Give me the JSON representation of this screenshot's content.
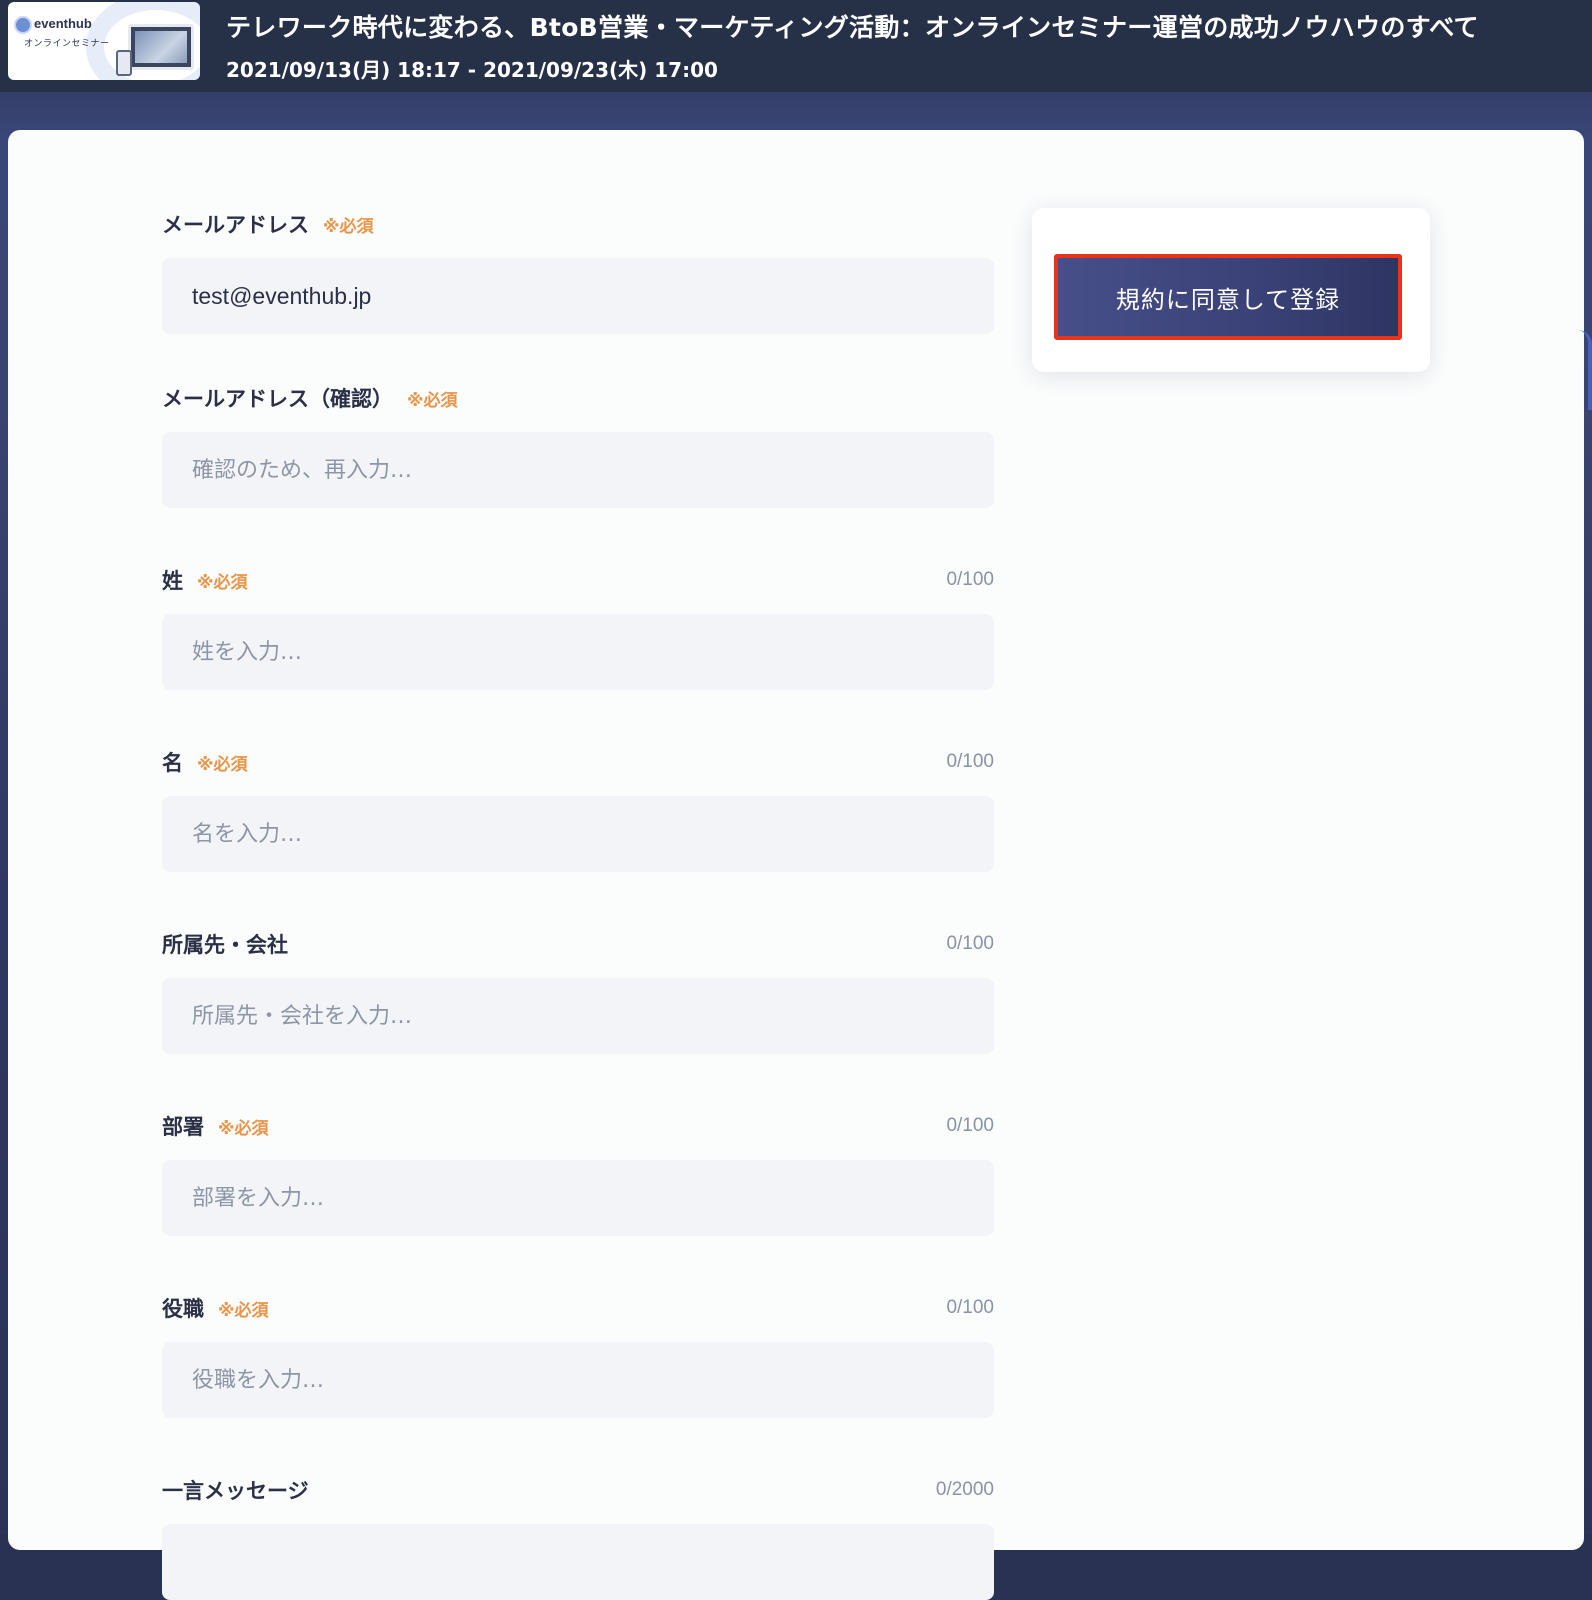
{
  "header": {
    "thumbnail": {
      "logo_text": "eventhub",
      "subtitle": "オンラインセミナー"
    },
    "event_title": "テレワーク時代に変わる、BtoB営業・マーケティング活動：オンラインセミナー運営の成功ノウハウのすべて",
    "event_period": "2021/09/13(月) 18:17 - 2021/09/23(木) 17:00"
  },
  "form": {
    "required_mark": "※必須",
    "fields": [
      {
        "label": "メールアドレス",
        "required": true,
        "counter": "",
        "value": "test@eventhub.jp",
        "placeholder": ""
      },
      {
        "label": "メールアドレス（確認）",
        "required": true,
        "counter": "",
        "value": "",
        "placeholder": "確認のため、再入力…"
      },
      {
        "label": "姓",
        "required": true,
        "counter": "0/100",
        "value": "",
        "placeholder": "姓を入力…"
      },
      {
        "label": "名",
        "required": true,
        "counter": "0/100",
        "value": "",
        "placeholder": "名を入力…"
      },
      {
        "label": "所属先・会社",
        "required": false,
        "counter": "0/100",
        "value": "",
        "placeholder": "所属先・会社を入力…"
      },
      {
        "label": "部署",
        "required": true,
        "counter": "0/100",
        "value": "",
        "placeholder": "部署を入力…"
      },
      {
        "label": "役職",
        "required": true,
        "counter": "0/100",
        "value": "",
        "placeholder": "役職を入力…"
      },
      {
        "label": "一言メッセージ",
        "required": false,
        "counter": "0/2000",
        "value": "",
        "placeholder": ""
      }
    ]
  },
  "side_panel": {
    "register_button_label": "規約に同意して登録"
  },
  "colors": {
    "header_bg": "#263046",
    "required": "#e8954a",
    "button_start": "#474f8a",
    "button_end": "#2e3563",
    "highlight_border": "#e8321c"
  }
}
